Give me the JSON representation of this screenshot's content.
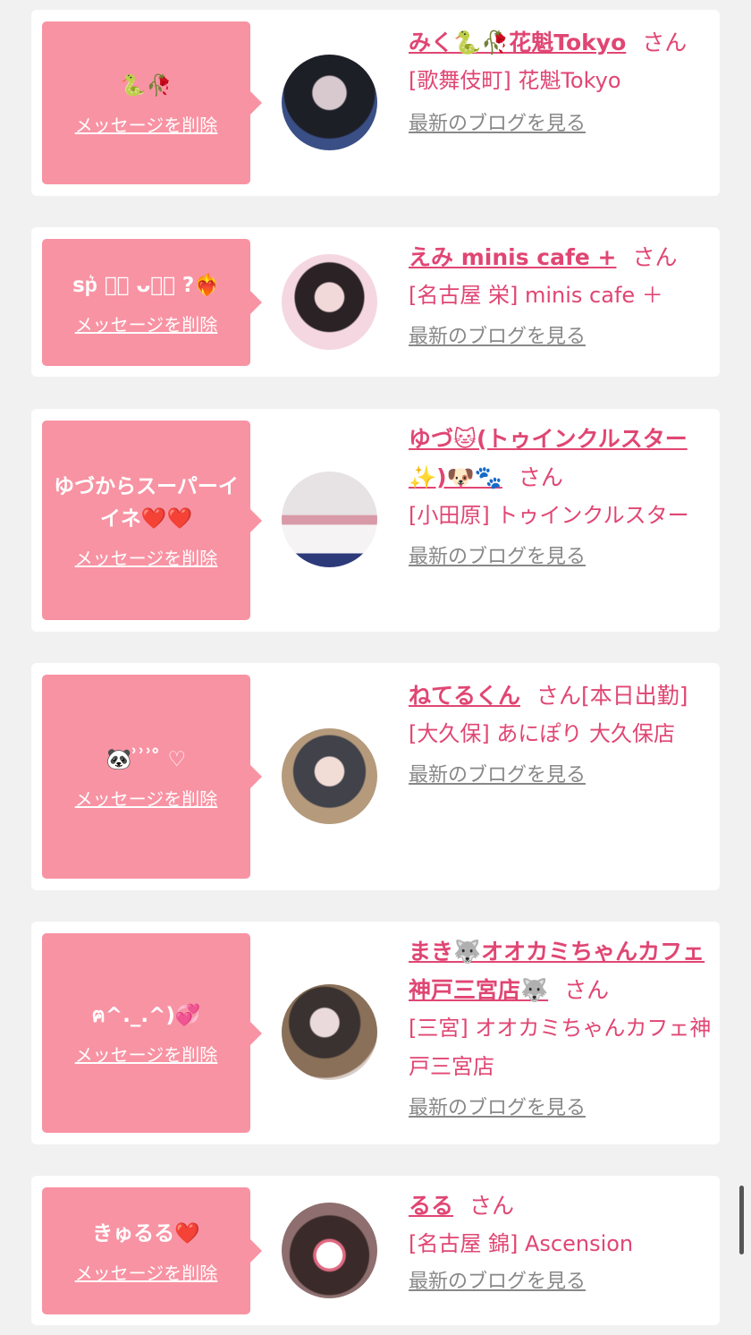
{
  "entries": [
    {
      "message": "🐍🥀",
      "delete_label": "メッセージを削除",
      "name": "みく🐍🥀花魁Tokyo",
      "san": "さん",
      "shop": "[歌舞伎町] 花魁Tokyo",
      "blog_label": "最新のブログを見る",
      "avatar_color": "#2c2f38"
    },
    {
      "message": "sp͛ ･ᷓ ᴗ･ᷓ ?❤️‍🔥",
      "delete_label": "メッセージを削除",
      "name": "えみ minis cafe +",
      "san": "さん",
      "shop": "[名古屋 栄] minis cafe ＋",
      "blog_label": "最新のブログを見る",
      "avatar_color": "#e9c8d2"
    },
    {
      "message": "ゆづからスーパーイイネ❤️❤️",
      "delete_label": "メッセージを削除",
      "name": "ゆづ🐱(トゥインクルスター✨)🐶🐾",
      "san": "さん",
      "shop": "[小田原] トゥインクルスター",
      "blog_label": "最新のブログを見る",
      "avatar_color": "#c8c1c4"
    },
    {
      "message": "🐼 ͗ ͗ ͗ ̊ ♡",
      "delete_label": "メッセージを削除",
      "name": "ねてるくん",
      "san": "さん[本日出勤]",
      "shop": "[大久保] あにぽり 大久保店",
      "blog_label": "最新のブログを見る",
      "avatar_color": "#8c8580"
    },
    {
      "message": "ฅ^._.^)💞",
      "delete_label": "メッセージを削除",
      "name": "まき🐺オオカミちゃんカフェ神戸三宮店🐺",
      "san": "さん",
      "shop": "[三宮] オオカミちゃんカフェ神戸三宮店",
      "blog_label": "最新のブログを見る",
      "avatar_color": "#7d7a78"
    },
    {
      "message": "きゅるる❤️",
      "delete_label": "メッセージを削除",
      "name": "るる",
      "san": "さん",
      "shop": "[名古屋 錦] Ascension",
      "blog_label": "最新のブログを見る",
      "avatar_color": "#b3949a"
    }
  ]
}
